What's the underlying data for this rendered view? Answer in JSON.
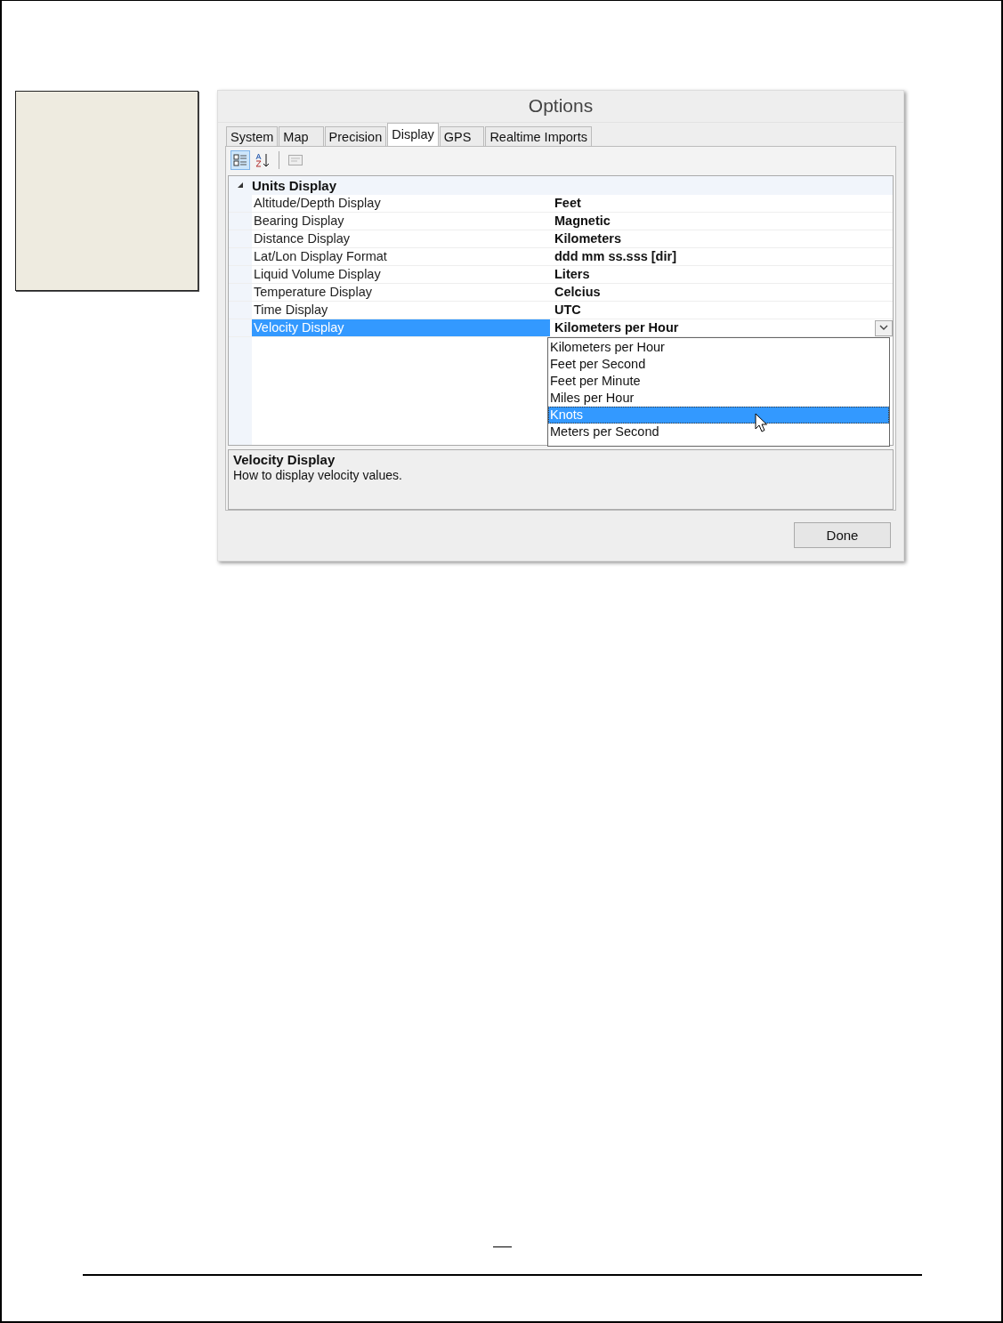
{
  "window": {
    "title": "Options"
  },
  "tabs": [
    {
      "label": "System",
      "selected": false
    },
    {
      "label": "Map",
      "selected": false
    },
    {
      "label": "Precision",
      "selected": false
    },
    {
      "label": "Display",
      "selected": true
    },
    {
      "label": "GPS",
      "selected": false
    },
    {
      "label": "Realtime Imports",
      "selected": false
    }
  ],
  "toolbar": [
    {
      "kind": "categorized",
      "selected": true
    },
    {
      "kind": "alphabetical",
      "selected": false
    },
    {
      "kind": "pages",
      "selected": false
    }
  ],
  "property_grid": {
    "category": {
      "title": "Units Display",
      "expanded": true
    },
    "rows": [
      {
        "name": "Altitude/Depth Display",
        "value": "Feet",
        "selected": false
      },
      {
        "name": "Bearing Display",
        "value": "Magnetic",
        "selected": false
      },
      {
        "name": "Distance Display",
        "value": "Kilometers",
        "selected": false
      },
      {
        "name": "Lat/Lon Display Format",
        "value": "ddd mm ss.sss [dir]",
        "selected": false
      },
      {
        "name": "Liquid Volume Display",
        "value": "Liters",
        "selected": false
      },
      {
        "name": "Temperature Display",
        "value": "Celcius",
        "selected": false
      },
      {
        "name": "Time Display",
        "value": "UTC",
        "selected": false
      },
      {
        "name": "Velocity Display",
        "value": "Kilometers per Hour",
        "selected": true
      }
    ],
    "dropdown": {
      "options": [
        {
          "label": "Kilometers per Hour",
          "selected": false
        },
        {
          "label": "Feet per Second",
          "selected": false
        },
        {
          "label": "Feet per Minute",
          "selected": false
        },
        {
          "label": "Miles per Hour",
          "selected": false
        },
        {
          "label": "Knots",
          "selected": true
        },
        {
          "label": "Meters per Second",
          "selected": false
        }
      ]
    }
  },
  "description": {
    "title": "Velocity Display",
    "text": "How to display velocity values."
  },
  "buttons": [
    {
      "label": "Done"
    }
  ]
}
